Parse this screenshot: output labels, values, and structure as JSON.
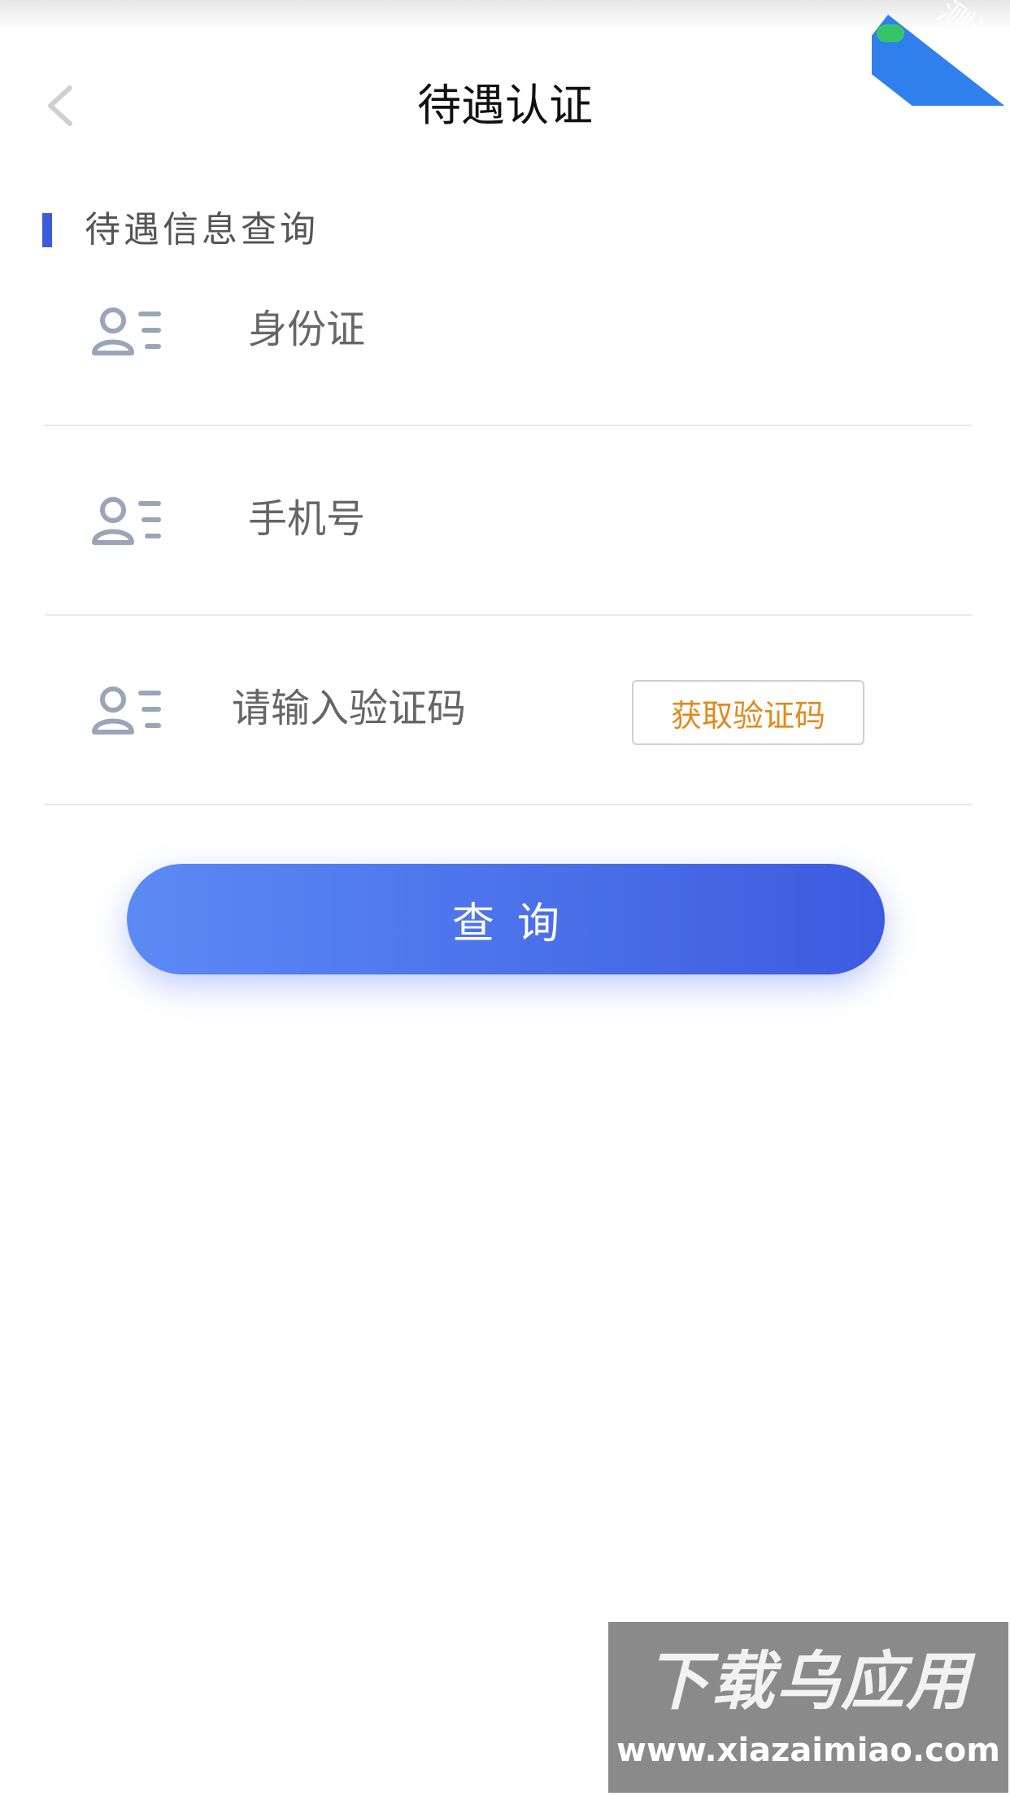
{
  "header": {
    "title": "待遇认证",
    "back_icon": "chevron-left-icon"
  },
  "badge": {
    "label": "测试",
    "color": "#2f80ed"
  },
  "section": {
    "title": "待遇信息查询",
    "accent_color": "#3b5bdb"
  },
  "form": {
    "id_card": {
      "placeholder": "身份证",
      "value": "",
      "icon": "user-list-icon"
    },
    "phone": {
      "placeholder": "手机号",
      "value": "",
      "icon": "user-list-icon"
    },
    "code": {
      "placeholder": "请输入验证码",
      "value": "",
      "icon": "user-list-icon"
    },
    "get_code_label": "获取验证码",
    "get_code_color": "#e08a1e"
  },
  "query_button": {
    "label": "查询",
    "gradient": [
      "#5b8af5",
      "#3d5be0"
    ]
  },
  "watermark": {
    "main": "下载乌应用",
    "url": "www.xiazaimiao.com"
  }
}
